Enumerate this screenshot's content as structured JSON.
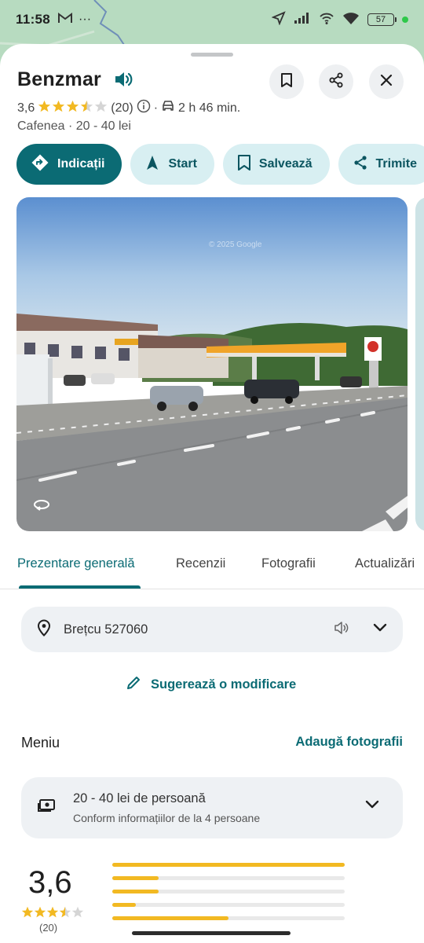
{
  "status_bar": {
    "time": "11:58",
    "battery": "57"
  },
  "place": {
    "title": "Benzmar",
    "rating": "3,6",
    "review_count": "(20)",
    "drive_time": "2 h 46 min.",
    "subtitle": "Cafenea · 20 - 40 lei"
  },
  "actions": [
    {
      "label": "Indicații",
      "icon": "directions-icon"
    },
    {
      "label": "Start",
      "icon": "navigation-arrow-icon"
    },
    {
      "label": "Salvează",
      "icon": "bookmark-icon"
    },
    {
      "label": "Trimite",
      "icon": "share-icon"
    }
  ],
  "photo": {
    "watermark": "© 2025 Google"
  },
  "tabs": [
    {
      "label": "Prezentare generală",
      "active": true
    },
    {
      "label": "Recenzii",
      "active": false
    },
    {
      "label": "Fotografii",
      "active": false
    },
    {
      "label": "Actualizări",
      "active": false
    }
  ],
  "address": {
    "text": "Brețcu 527060"
  },
  "suggest_edit": "Sugerează o modificare",
  "menu": {
    "title": "Meniu",
    "add_photos": "Adaugă fotografii"
  },
  "price": {
    "line1": "20 - 40 lei de persoană",
    "line2": "Conform informațiilor de la 4 persoane"
  },
  "rating_summary": {
    "value": "3,6",
    "stars": 3.5,
    "count": "(20)",
    "distribution": [
      1.0,
      0.2,
      0.2,
      0.1,
      0.5
    ]
  },
  "colors": {
    "accent": "#0b6b74",
    "star": "#f2b922",
    "chip_bg": "#d8eff2"
  }
}
